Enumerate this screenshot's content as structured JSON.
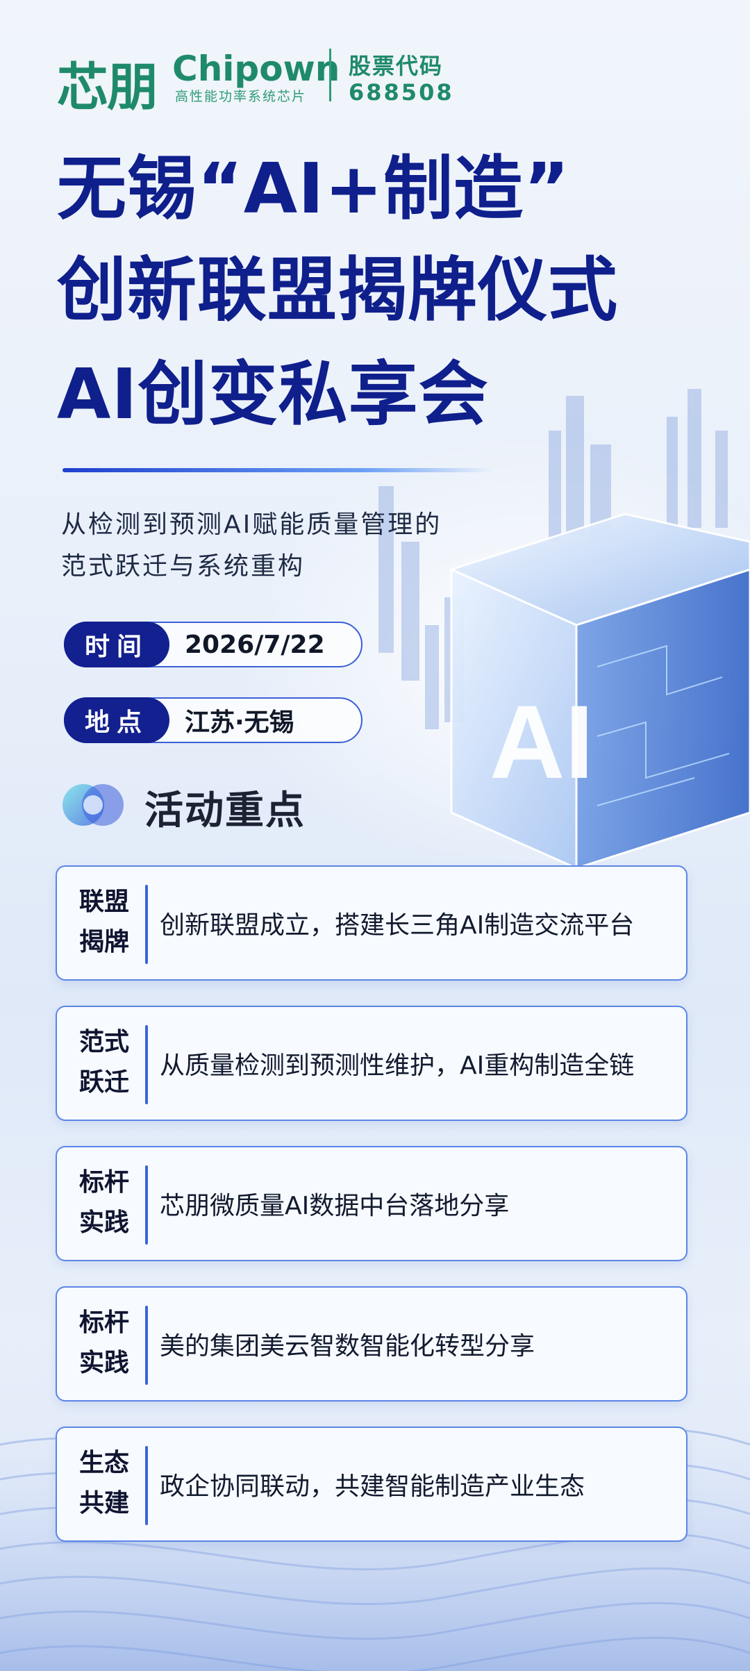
{
  "header": {
    "brand_cn": "芯朋",
    "brand_en": "Chipown",
    "brand_sub": "高性能功率系统芯片",
    "stock_label": "股票代码",
    "stock_code": "688508"
  },
  "title": {
    "line1": "无锡“AI+制造”",
    "line2": "创新联盟揭牌仪式",
    "line3": "AI创变私享会"
  },
  "subtitle": {
    "line1": "从检测到预测AI赋能质量管理的",
    "line2": "范式跃迁与系统重构"
  },
  "info": {
    "time_label": "时间",
    "time_value": "2026/7/22",
    "place_label": "地点",
    "place_value": "江苏·无锡"
  },
  "hero_text": "AI",
  "section_title": "活动重点",
  "cards": [
    {
      "tag_line1": "联盟",
      "tag_line2": "揭牌",
      "text": "创新联盟成立，搭建长三角AI制造交流平台"
    },
    {
      "tag_line1": "范式",
      "tag_line2": "跃迁",
      "text": "从质量检测到预测性维护，AI重构制造全链"
    },
    {
      "tag_line1": "标杆",
      "tag_line2": "实践",
      "text": "芯朋微质量AI数据中台落地分享"
    },
    {
      "tag_line1": "标杆",
      "tag_line2": "实践",
      "text": "美的集团美云智数智能化转型分享"
    },
    {
      "tag_line1": "生态",
      "tag_line2": "共建",
      "text": "政企协同联动，共建智能制造产业生态"
    }
  ],
  "colors": {
    "brand_green": "#1f8a6b",
    "title_navy": "#0f1f8c",
    "accent_blue": "#3b64d8"
  }
}
